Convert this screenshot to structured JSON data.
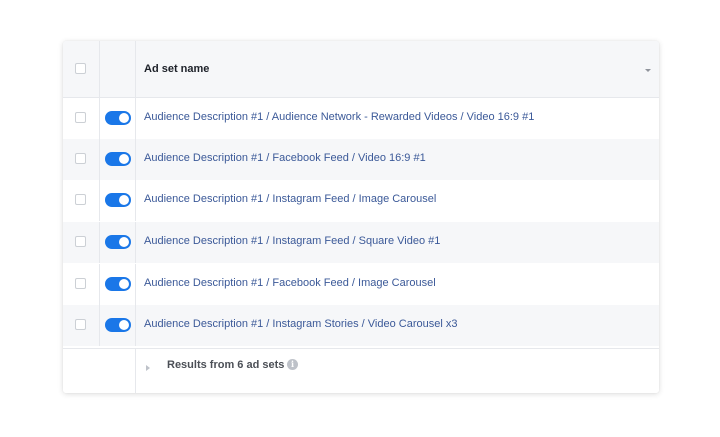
{
  "table": {
    "header": {
      "title": "Ad set name"
    },
    "rows": [
      {
        "name": "Audience Description #1 / Audience Network - Rewarded Videos / Video 16:9 #1",
        "enabled": true
      },
      {
        "name": "Audience Description #1 / Facebook Feed / Video 16:9 #1",
        "enabled": true
      },
      {
        "name": "Audience Description #1 / Instagram Feed / Image Carousel",
        "enabled": true
      },
      {
        "name": "Audience Description #1 / Instagram Feed / Square Video #1",
        "enabled": true
      },
      {
        "name": "Audience Description #1 / Facebook Feed / Image Carousel",
        "enabled": true
      },
      {
        "name": "Audience Description #1 / Instagram Stories / Video Carousel x3",
        "enabled": true
      }
    ],
    "footer": {
      "text": "Results from 6 ad sets",
      "info_icon": "i"
    }
  },
  "colors": {
    "toggle_on": "#1a77e8",
    "link_text": "#3b5998",
    "row_alt_bg": "#f6f7f9"
  },
  "icons": {
    "sort": "chevron-down-icon",
    "expand": "chevron-right-icon",
    "info": "info-icon"
  }
}
